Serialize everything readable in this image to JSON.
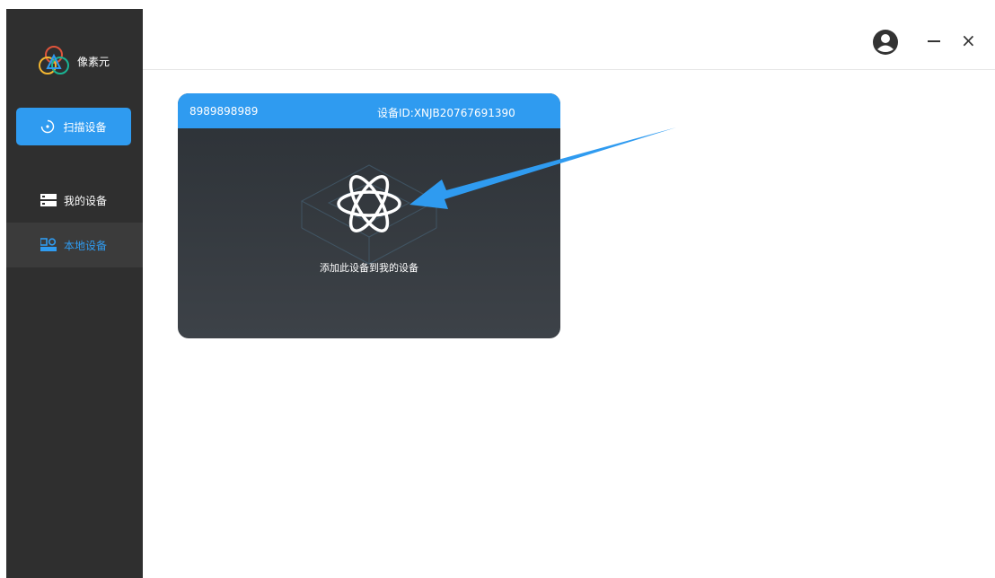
{
  "app": {
    "name": "像素元",
    "logo_colors": [
      "#e0543b",
      "#f2b631",
      "#2f9bf0",
      "#1ab394"
    ]
  },
  "sidebar": {
    "scan_button": {
      "label": "扫描设备",
      "icon": "scan-icon"
    },
    "items": [
      {
        "label": "我的设备",
        "icon": "server-icon",
        "active": false
      },
      {
        "label": "本地设备",
        "icon": "local-device-icon",
        "active": true
      }
    ]
  },
  "header": {
    "icons": [
      "user-account-icon",
      "minimize-icon",
      "close-icon"
    ],
    "close_glyph": "×"
  },
  "device_card": {
    "name": "8989898989",
    "device_id": "设备ID:XNJB20767691390",
    "icon": "atom-icon",
    "action_text": "添加此设备到我的设备"
  },
  "colors": {
    "accent": "#2f9bf0",
    "sidebar_bg": "#2f2f2f",
    "sidebar_active_bg": "#3b3b3b",
    "card_bg": "#34393f"
  }
}
